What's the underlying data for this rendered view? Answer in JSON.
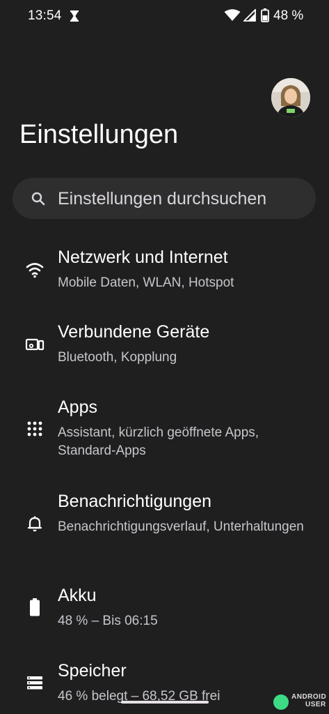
{
  "status_bar": {
    "time": "13:54",
    "battery_percent": "48 %",
    "icons": [
      "hourglass-icon",
      "wifi-icon",
      "signal-icon",
      "battery-icon"
    ]
  },
  "profile": {
    "avatar": "avatar"
  },
  "page": {
    "title": "Einstellungen"
  },
  "search": {
    "placeholder": "Einstellungen durchsuchen",
    "icon": "search-icon"
  },
  "items": [
    {
      "title": "Netzwerk und Internet",
      "subtitle": "Mobile Daten, WLAN, Hotspot",
      "icon": "wifi-icon"
    },
    {
      "title": "Verbundene Geräte",
      "subtitle": "Bluetooth, Kopplung",
      "icon": "connected-devices-icon"
    },
    {
      "title": "Apps",
      "subtitle": "Assistant, kürzlich geöffnete Apps, Standard-Apps",
      "icon": "apps-grid-icon"
    },
    {
      "title": "Benachrichtigungen",
      "subtitle": "Benachrichtigungsverlauf, Unterhaltungen",
      "icon": "bell-icon"
    },
    {
      "title": "Akku",
      "subtitle": "48 % – Bis 06:15",
      "icon": "battery-icon"
    },
    {
      "title": "Speicher",
      "subtitle": "46 % belegt – 68,52 GB frei",
      "icon": "storage-icon"
    }
  ],
  "watermark": {
    "line1": "ANDROID",
    "line2": "USER"
  },
  "colors": {
    "background": "#1f1f1f",
    "search_bar": "#2e2e2e",
    "text_primary": "#ffffff",
    "text_secondary": "#c8c5cc"
  }
}
